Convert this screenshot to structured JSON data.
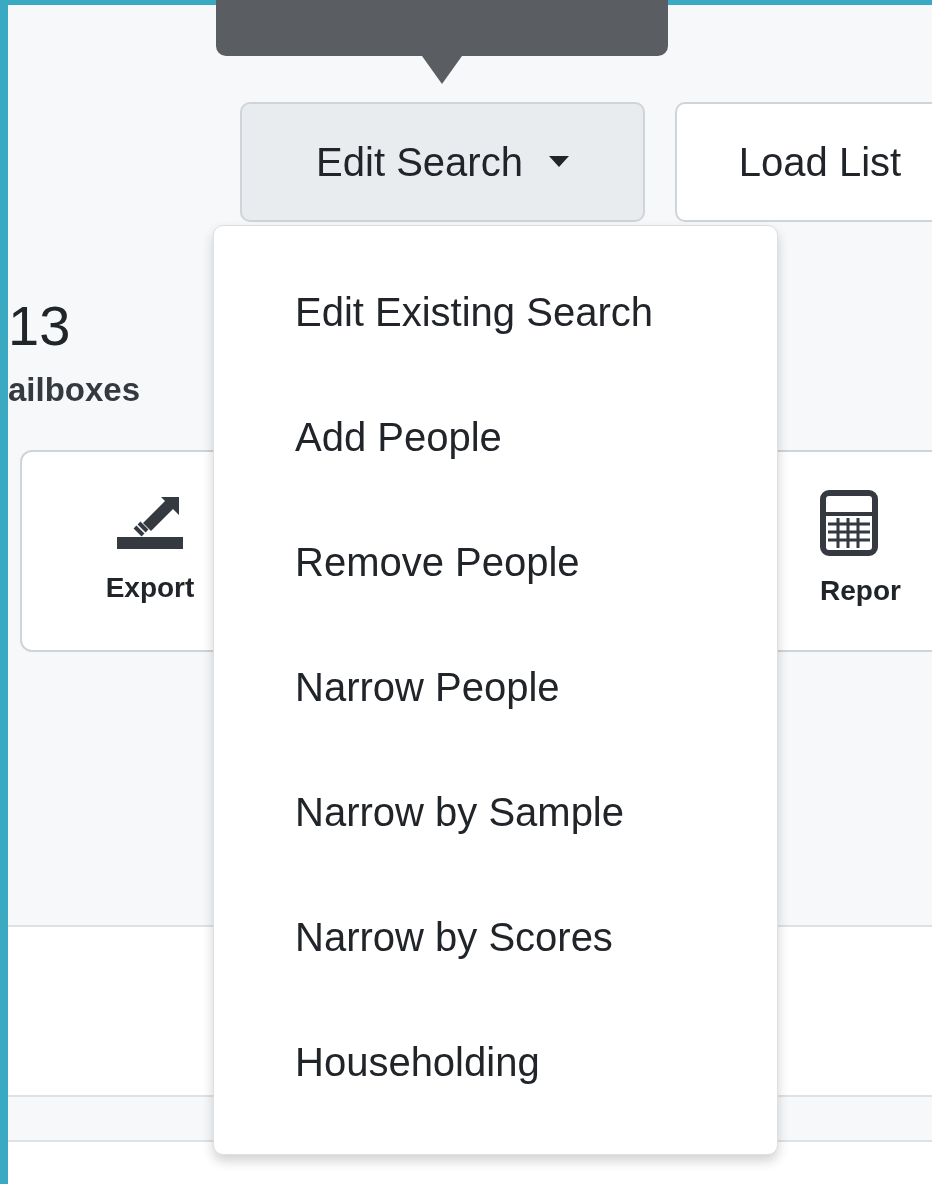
{
  "buttons": [
    {
      "label": "Edit Search",
      "kind": "dropdown",
      "expanded": true
    },
    {
      "label": "Load List",
      "kind": "button",
      "expanded": false
    }
  ],
  "dropdown_menu": [
    "Edit Existing Search",
    "Add People",
    "Remove People",
    "Narrow People",
    "Narrow by Sample",
    "Narrow by Scores",
    "Householding"
  ],
  "stat": {
    "value": "13",
    "label": "ailboxes"
  },
  "actions": [
    {
      "label": "Export",
      "kind": "export"
    },
    {
      "label": "Repor",
      "kind": "report"
    }
  ]
}
